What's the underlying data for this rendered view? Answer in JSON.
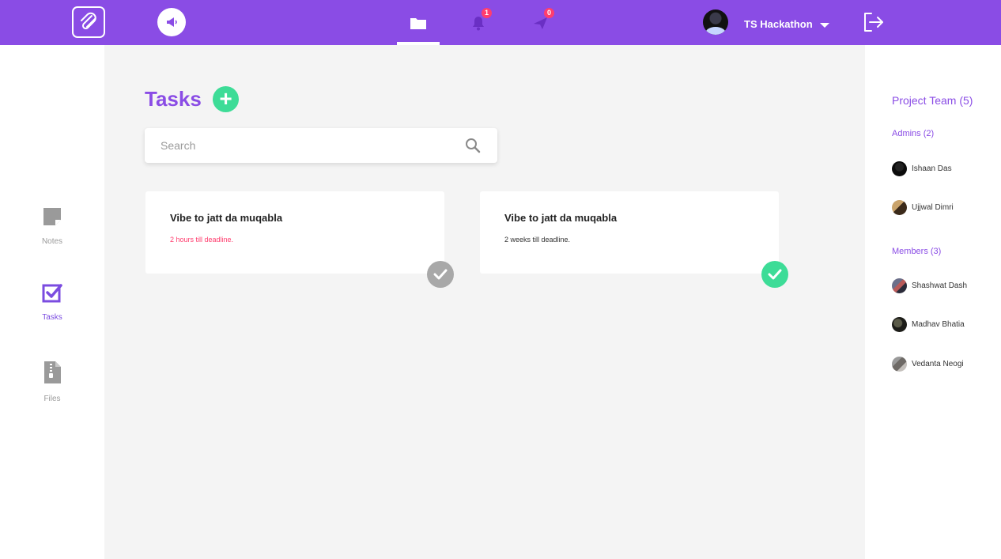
{
  "header": {
    "user_name": "TS Hackathon",
    "notifications_count": "1",
    "messages_count": "0"
  },
  "sidebar": {
    "items": [
      {
        "label": "Notes",
        "icon": "note-icon"
      },
      {
        "label": "Tasks",
        "icon": "checkbox-icon",
        "active": true
      },
      {
        "label": "Files",
        "icon": "zip-file-icon"
      }
    ]
  },
  "main": {
    "title": "Tasks",
    "search": {
      "placeholder": "Search"
    },
    "tasks": [
      {
        "title": "Vibe to jatt da muqabla",
        "deadline": "2 hours till deadline.",
        "urgent": true,
        "completed": false
      },
      {
        "title": "Vibe to jatt da muqabla",
        "deadline": "2 weeks till deadline.",
        "urgent": false,
        "completed": true
      }
    ]
  },
  "team": {
    "title": "Project Team (5)",
    "admins_label": "Admins (2)",
    "admins": [
      {
        "name": "Ishaan Das"
      },
      {
        "name": "Ujjwal Dimri"
      }
    ],
    "members_label": "Members (3)",
    "members": [
      {
        "name": "Shashwat Dash"
      },
      {
        "name": "Madhav Bhatia"
      },
      {
        "name": "Vedanta Neogi"
      }
    ]
  },
  "colors": {
    "brand": "#8a4ce5",
    "success": "#3ddc97",
    "danger": "#ff3d6e"
  }
}
